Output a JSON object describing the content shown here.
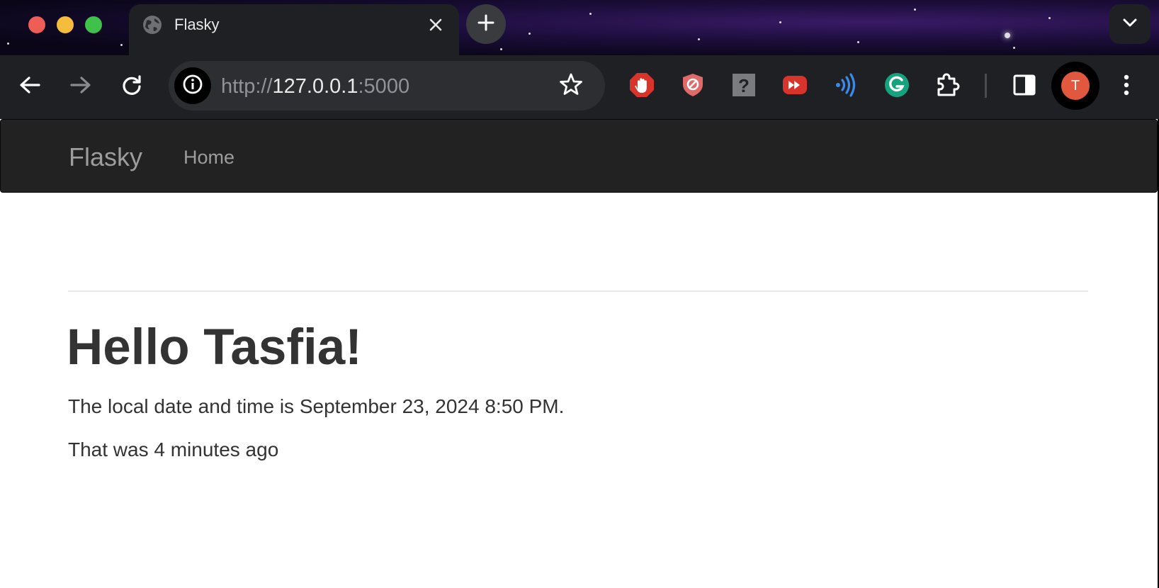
{
  "browser": {
    "tab": {
      "title": "Flasky"
    },
    "url": {
      "scheme": "http://",
      "host": "127.0.0.1",
      "port": ":5000"
    },
    "profile_initial": "T",
    "icons": {
      "tab_favicon": "globe-icon",
      "close_tab": "close-icon",
      "new_tab": "plus-icon",
      "tab_search": "chevron-down-icon",
      "back": "arrow-left-icon",
      "forward": "arrow-right-icon",
      "reload": "reload-icon",
      "site_info": "info-icon",
      "bookmark": "star-icon",
      "extensions": [
        "adblock-hand-icon",
        "shield-block-icon",
        "help-icon",
        "fast-forward-icon",
        "wave-icon",
        "grammarly-icon",
        "puzzle-icon"
      ],
      "side_panel": "side-panel-icon",
      "menu": "kebab-menu-icon"
    },
    "colors": {
      "avatar": "#e2583e",
      "navbar": "#222222"
    }
  },
  "page": {
    "navbar": {
      "brand": "Flasky",
      "home": "Home"
    },
    "heading": "Hello Tasfia!",
    "local_time_line": "The local date and time is September 23, 2024 8:50 PM.",
    "relative_time_line": "That was 4 minutes ago"
  }
}
